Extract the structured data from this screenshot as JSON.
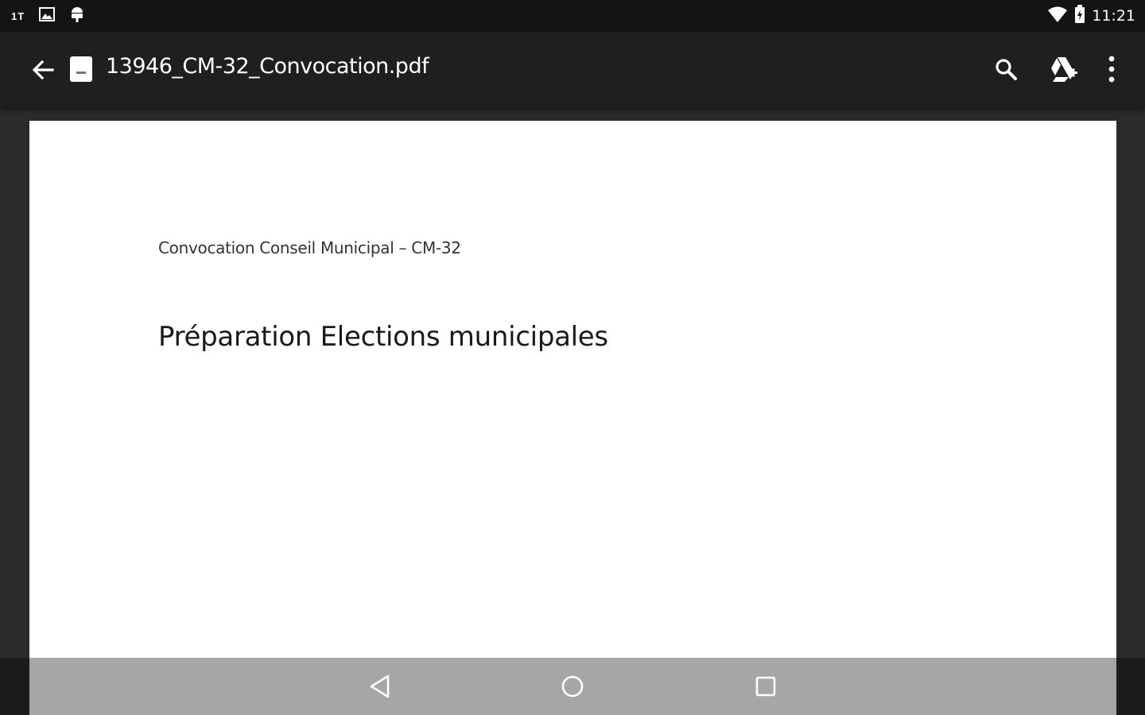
{
  "status_bar": {
    "carrier": "1T",
    "time": "11:21",
    "icons": [
      "image-icon",
      "android-icon",
      "wifi-icon",
      "battery-icon"
    ]
  },
  "app_bar": {
    "title": "13946_CM-32_Convocation.pdf",
    "file_icon_label": "PDF",
    "actions": [
      "search-icon",
      "google-drive-add-icon",
      "more-vert-icon"
    ]
  },
  "document": {
    "header_line": "Convocation Conseil Municipal – CM-32",
    "heading": "Préparation Elections municipales"
  },
  "nav_bar": {
    "buttons": [
      "back-triangle-icon",
      "home-circle-icon",
      "recents-square-icon"
    ]
  },
  "colors": {
    "status_bar": "#141414",
    "app_bar": "#1f1f1f",
    "viewer_background": "#2b2b2b",
    "page": "#ffffff",
    "nav_bar": "#9a9a9a"
  }
}
